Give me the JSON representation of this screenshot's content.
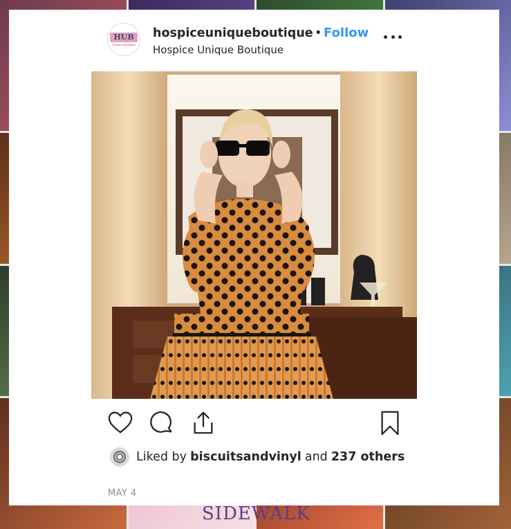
{
  "background": {
    "tile_caption": "SIDEWALK"
  },
  "post": {
    "username": "hospiceuniqueboutique",
    "separator": "•",
    "follow_label": "Follow",
    "location": "Hospice Unique Boutique",
    "avatar_logo_text": "HUB",
    "avatar_logo_subtext": "Unique Boutique",
    "image_description_icon": "photo",
    "actions": {
      "like_icon": "heart-icon",
      "comment_icon": "comment-icon",
      "share_icon": "share-icon",
      "save_icon": "bookmark-icon"
    },
    "likes": {
      "prefix": "Liked by",
      "user": "biscuitsandvinyl",
      "conjunction": "and",
      "others": "237 others"
    },
    "date": "MAY 4"
  },
  "colors": {
    "link": "#3897f0",
    "text": "#262626",
    "muted": "#8e8e8e"
  }
}
